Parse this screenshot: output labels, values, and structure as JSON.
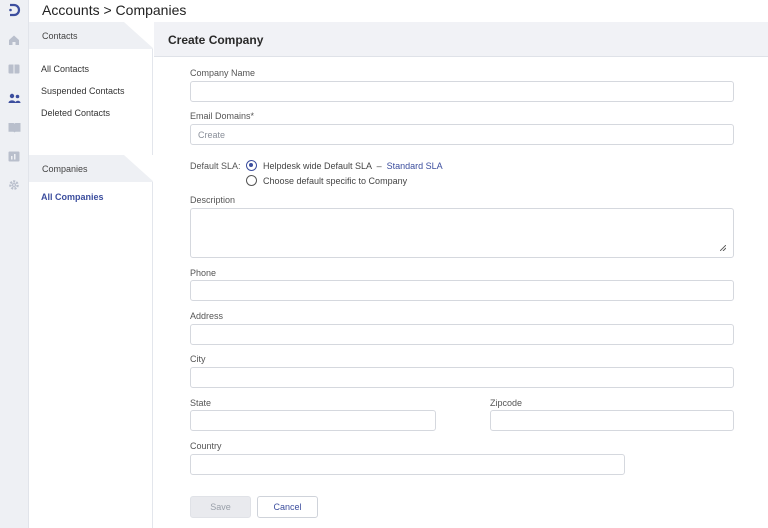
{
  "breadcrumb": "Accounts > Companies",
  "rail": {
    "icons": [
      "logo-icon",
      "home-icon",
      "tickets-icon",
      "contacts-icon",
      "knowledge-base-icon",
      "reports-icon",
      "settings-icon"
    ]
  },
  "sidebar": {
    "contacts_header": "Contacts",
    "contacts_items": [
      "All Contacts",
      "Suspended Contacts",
      "Deleted Contacts"
    ],
    "companies_header": "Companies",
    "companies_items": [
      "All Companies"
    ]
  },
  "form": {
    "title": "Create Company",
    "company_name_label": "Company Name",
    "company_name_value": "",
    "email_domains_label": "Email Domains*",
    "email_domains_placeholder": "Create",
    "default_sla_label": "Default SLA:",
    "sla_option_1": "Helpdesk wide Default SLA",
    "sla_separator": "–",
    "sla_option_1_link": "Standard SLA",
    "sla_option_2": "Choose default specific to Company",
    "description_label": "Description",
    "phone_label": "Phone",
    "address_label": "Address",
    "city_label": "City",
    "state_label": "State",
    "zipcode_label": "Zipcode",
    "country_label": "Country",
    "save_label": "Save",
    "cancel_label": "Cancel"
  },
  "colors": {
    "accent": "#3c4e9e",
    "rail_bg": "#eef0f4",
    "header_bg": "#f1f2f6"
  }
}
